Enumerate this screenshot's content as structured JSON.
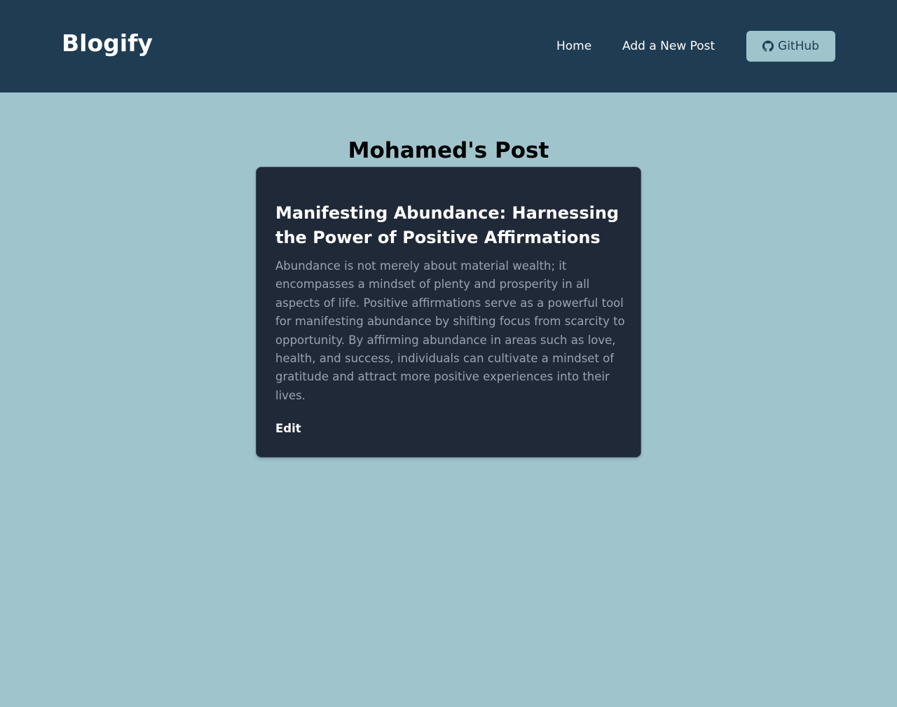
{
  "app": {
    "brand": "Blogify"
  },
  "nav": {
    "home_label": "Home",
    "add_label": "Add a New Post",
    "github_label": "GitHub",
    "github_icon": "github-icon"
  },
  "page": {
    "title": "Mohamed's Post"
  },
  "post": {
    "title": "Manifesting Abundance: Harnessing the Power of Positive Affirmations",
    "body": "Abundance is not merely about material wealth; it encompasses a mindset of plenty and prosperity in all aspects of life. Positive affirmations serve as a powerful tool for manifesting abundance by shifting focus from scarcity to opportunity. By affirming abundance in areas such as love, health, and success, individuals can cultivate a mindset of gratitude and attract more positive experiences into their lives.",
    "edit_label": "Edit"
  },
  "colors": {
    "header_bg": "#1f3c53",
    "page_bg": "#9fc4cc",
    "card_bg": "#202938",
    "muted_text": "#9aa3b2",
    "white": "#ffffff"
  }
}
